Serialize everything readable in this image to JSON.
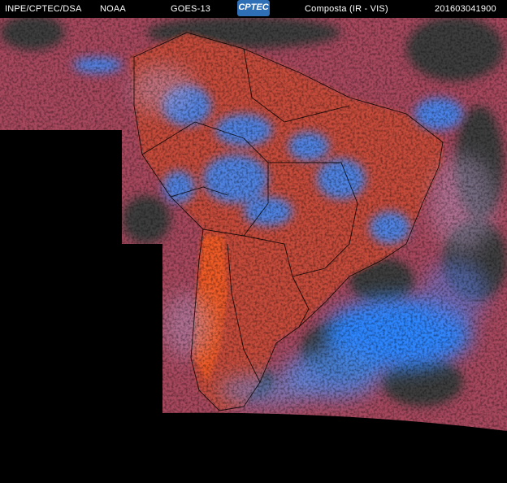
{
  "header": {
    "source": "INPE/CPTEC/DSA",
    "agency": "NOAA",
    "satellite": "GOES-13",
    "logo_text": "CPTEC",
    "product": "Composta (IR - VIS)",
    "timestamp": "201603041900"
  },
  "colors": {
    "background": "#000000",
    "land_surface": "#b84a4a",
    "hot_continent": "#e85a2a",
    "high_cloud": "#3a8cff",
    "cirrus": "#6a9cf0",
    "low_cloud_dark": "#3b3b3b",
    "border_lines": "#000000",
    "logo_bg": "#2f6fb5"
  }
}
